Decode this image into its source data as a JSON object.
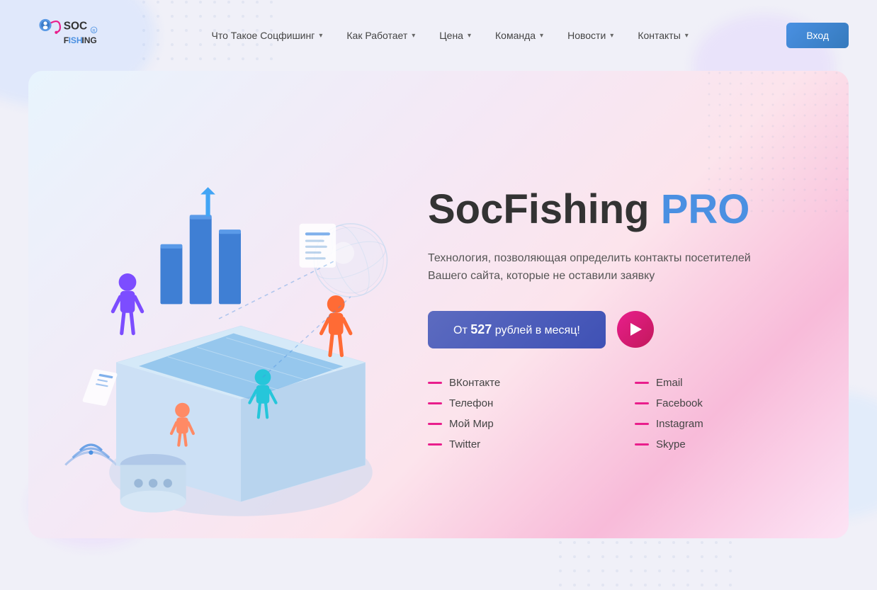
{
  "brand": {
    "name": "SocFishing"
  },
  "header": {
    "login_label": "Вход",
    "nav_items": [
      {
        "id": "what",
        "label": "Что Такое Соцфишинг",
        "has_dropdown": true
      },
      {
        "id": "how",
        "label": "Как Работает",
        "has_dropdown": true
      },
      {
        "id": "price",
        "label": "Цена",
        "has_dropdown": true
      },
      {
        "id": "team",
        "label": "Команда",
        "has_dropdown": true
      },
      {
        "id": "news",
        "label": "Новости",
        "has_dropdown": true
      },
      {
        "id": "contacts",
        "label": "Контакты",
        "has_dropdown": true
      }
    ]
  },
  "hero": {
    "title_main": "SocFish",
    "title_mid": "ing",
    "title_pro": "PRO",
    "subtitle": "Технология, позволяющая определить контакты посетителей Вашего сайта, которые не оставили заявку",
    "cta_label_pre": "От",
    "cta_price": "527",
    "cta_label_post": "рублей в месяц!",
    "features": [
      {
        "id": "vk",
        "label": "ВКонтакте",
        "col": 1
      },
      {
        "id": "phone",
        "label": "Телефон",
        "col": 1
      },
      {
        "id": "mymil",
        "label": "Мой Мир",
        "col": 1
      },
      {
        "id": "twitter",
        "label": "Twitter",
        "col": 1
      },
      {
        "id": "email",
        "label": "Email",
        "col": 2
      },
      {
        "id": "facebook",
        "label": "Facebook",
        "col": 2
      },
      {
        "id": "instagram",
        "label": "Instagram",
        "col": 2
      },
      {
        "id": "skype",
        "label": "Skype",
        "col": 2
      }
    ]
  },
  "colors": {
    "accent_blue": "#4a90e2",
    "accent_pink": "#e91e8c",
    "dash_pink": "#e84393",
    "text_dark": "#333333",
    "text_mid": "#555555"
  }
}
